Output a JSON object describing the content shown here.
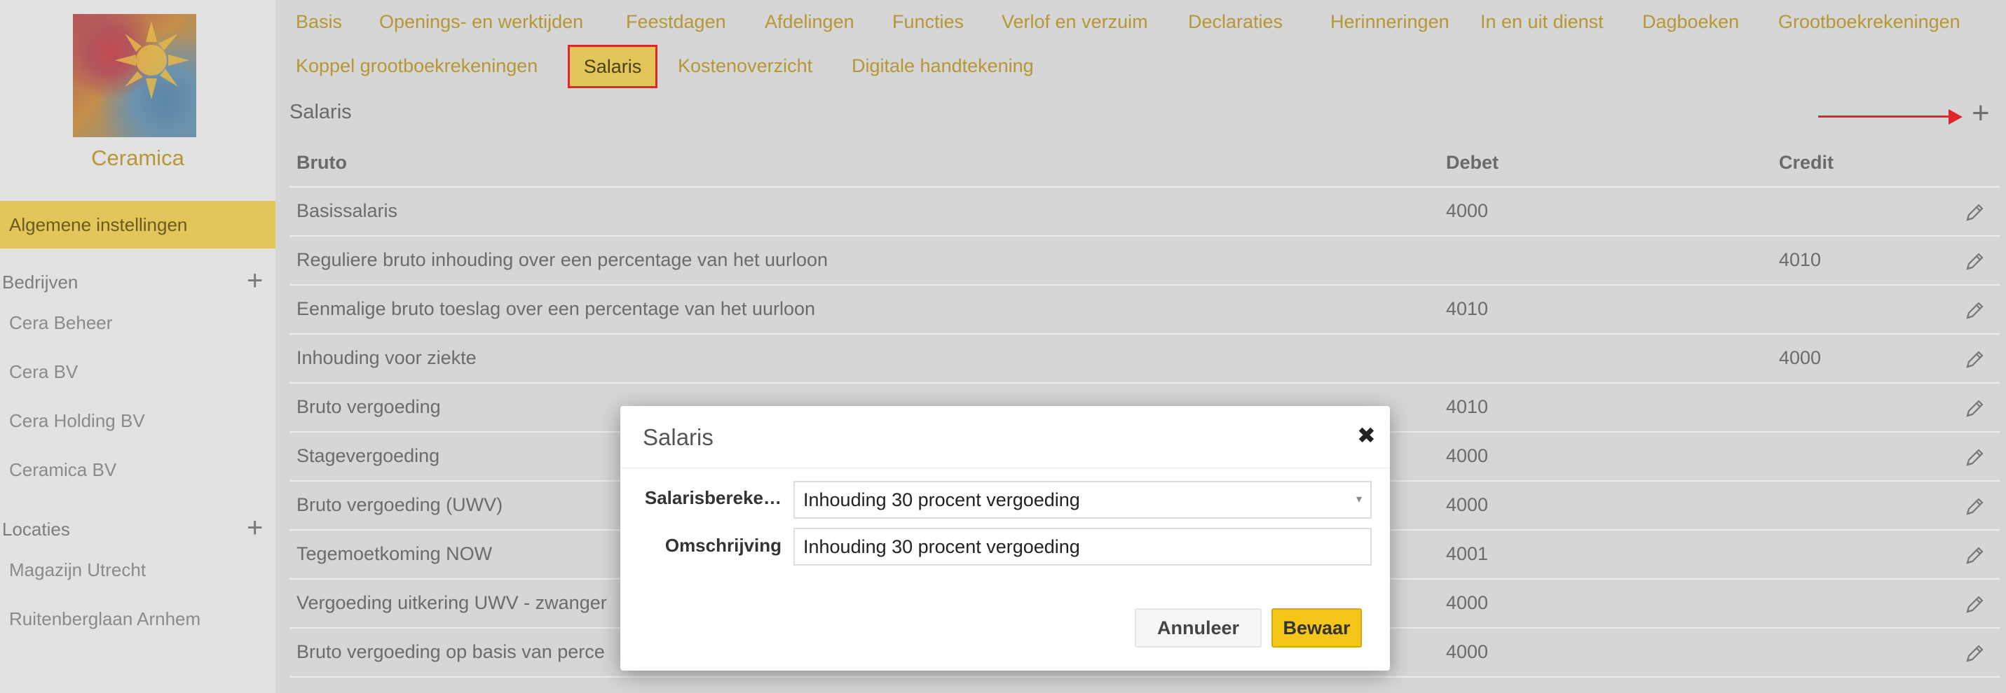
{
  "sidebar": {
    "company_name": "Ceramica",
    "active_item": "Algemene instellingen",
    "sections": [
      {
        "title": "Bedrijven",
        "items": [
          "Cera Beheer",
          "Cera BV",
          "Cera Holding BV",
          "Ceramica BV"
        ]
      },
      {
        "title": "Locaties",
        "items": [
          "Magazijn Utrecht",
          "Ruitenberglaan Arnhem"
        ]
      }
    ],
    "plus_glyph": "+"
  },
  "nav": {
    "row1": [
      "Basis",
      "Openings- en werktijden",
      "Feestdagen",
      "Afdelingen",
      "Functies",
      "Verlof en verzuim",
      "Declaraties",
      "Herinneringen",
      "In en uit dienst",
      "Dagboeken",
      "Grootboekrekeningen"
    ],
    "row2": [
      "Koppel grootboekrekeningen",
      "Salaris",
      "Kostenoverzicht",
      "Digitale handtekening"
    ],
    "active": "Salaris"
  },
  "section": {
    "title": "Salaris",
    "add_glyph": "+"
  },
  "table": {
    "headers": [
      "Bruto",
      "Debet",
      "Credit"
    ],
    "rows": [
      {
        "name": "Basissalaris",
        "debet": "4000",
        "credit": ""
      },
      {
        "name": "Reguliere bruto inhouding over een percentage van het uurloon",
        "debet": "",
        "credit": "4010"
      },
      {
        "name": "Eenmalige bruto toeslag over een percentage van het uurloon",
        "debet": "4010",
        "credit": ""
      },
      {
        "name": "Inhouding voor ziekte",
        "debet": "",
        "credit": "4000"
      },
      {
        "name": "Bruto vergoeding",
        "debet": "4010",
        "credit": ""
      },
      {
        "name": "Stagevergoeding",
        "debet": "4000",
        "credit": ""
      },
      {
        "name": "Bruto vergoeding (UWV)",
        "debet": "4000",
        "credit": ""
      },
      {
        "name": "Tegemoetkoming NOW",
        "debet": "4001",
        "credit": ""
      },
      {
        "name": "Vergoeding uitkering UWV - zwanger",
        "debet": "4000",
        "credit": ""
      },
      {
        "name": "Bruto vergoeding op basis van perce",
        "debet": "4000",
        "credit": ""
      }
    ]
  },
  "modal": {
    "title": "Salaris",
    "close_glyph": "✖",
    "fields": [
      {
        "label": "Salarisbereke…",
        "value": "Inhouding 30 procent vergoeding",
        "caret": "▾"
      },
      {
        "label": "Omschrijving",
        "value": "Inhouding 30 procent vergoeding"
      }
    ],
    "cancel_label": "Annuleer",
    "save_label": "Bewaar"
  },
  "colors": {
    "accent": "#b59734",
    "active_bg": "#e2c65a",
    "highlight_red": "#e0262a",
    "save_button": "#f5c518"
  }
}
